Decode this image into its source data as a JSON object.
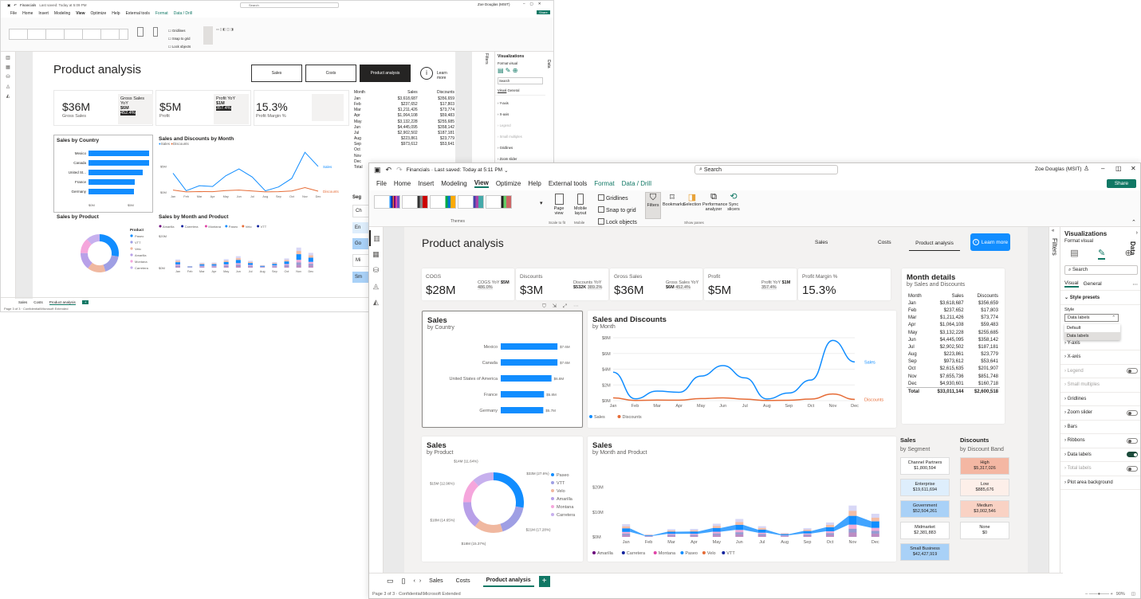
{
  "app": {
    "filename": "Financials",
    "saved": "Last saved: Today at 5:11 PM",
    "search_placeholder": "Search",
    "user": "Zoe Douglas (MSIT)",
    "share": "Share"
  },
  "back_app": {
    "saved": "Last saved: Today at 5:09 PM",
    "user": "Zoe Douglas (MSIT)"
  },
  "menu": [
    "File",
    "Home",
    "Insert",
    "Modeling",
    "View",
    "Optimize",
    "Help",
    "External tools",
    "Format",
    "Data / Drill"
  ],
  "ribbon": {
    "themes_label": "Themes",
    "page_view": "Page view",
    "mobile_layout": "Mobile layout",
    "scale_to_fit": "Scale to fit",
    "mobile": "Mobile",
    "gridlines": "Gridlines",
    "snap_to_grid": "Snap to grid",
    "lock_objects": "Lock objects",
    "filters": "Filters",
    "bookmarks": "Bookmarks",
    "selection": "Selection",
    "performance": "Performance analyzer",
    "sync": "Sync slicers",
    "show_panes": "Show panes"
  },
  "report": {
    "title": "Product analysis",
    "nav": [
      "Sales",
      "Costs",
      "Product analysis"
    ],
    "learn_more": "Learn more",
    "kpis": [
      {
        "label": "COGS",
        "value": "$28M",
        "sub_label": "COGS YoY",
        "sub_value": "$5M",
        "sub_pct": "486.0%"
      },
      {
        "label": "Discounts",
        "value": "$3M",
        "sub_label": "Discounts YoY",
        "sub_value": "$532K",
        "sub_pct": "389.2%"
      },
      {
        "label": "Gross Sales",
        "value": "$36M",
        "sub_label": "Gross Sales YoY",
        "sub_value": "$6M",
        "sub_pct": "452.4%"
      },
      {
        "label": "Profit",
        "value": "$5M",
        "sub_label": "Profit YoY",
        "sub_value": "$1M",
        "sub_pct": "357.4%"
      },
      {
        "label": "Profit Margin %",
        "value": "15.3%"
      }
    ],
    "month_details": {
      "title": "Month details",
      "subtitle": "by Sales and Discounts",
      "headers": [
        "Month",
        "Sales",
        "Discounts"
      ],
      "rows": [
        [
          "Jan",
          "$3,618,687",
          "$356,659"
        ],
        [
          "Feb",
          "$237,652",
          "$17,803"
        ],
        [
          "Mar",
          "$1,211,426",
          "$73,774"
        ],
        [
          "Apr",
          "$1,064,108",
          "$59,483"
        ],
        [
          "May",
          "$3,132,228",
          "$255,685"
        ],
        [
          "Jun",
          "$4,445,095",
          "$358,142"
        ],
        [
          "Jul",
          "$2,902,502",
          "$187,181"
        ],
        [
          "Aug",
          "$223,861",
          "$23,779"
        ],
        [
          "Sep",
          "$973,612",
          "$53,641"
        ],
        [
          "Oct",
          "$2,615,635",
          "$201,907"
        ],
        [
          "Nov",
          "$7,655,736",
          "$851,748"
        ],
        [
          "Dec",
          "$4,930,601",
          "$160,718"
        ]
      ],
      "total": [
        "Total",
        "$33,011,144",
        "$2,600,518"
      ]
    },
    "sales_country": {
      "title": "Sales",
      "subtitle": "by Country"
    },
    "sales_discounts": {
      "title": "Sales and Discounts",
      "subtitle": "by Month"
    },
    "sales_product": {
      "title": "Sales",
      "subtitle": "by Product"
    },
    "sales_month_product": {
      "title": "Sales",
      "subtitle": "by Month and Product"
    },
    "segment": {
      "title": "Sales",
      "subtitle": "by Segment",
      "items": [
        {
          "name": "Channel Partners",
          "value": "$1,800,594",
          "color": "#ffffff"
        },
        {
          "name": "Enterprise",
          "value": "$19,611,694",
          "color": "#deeefc"
        },
        {
          "name": "Government",
          "value": "$52,504,261",
          "color": "#a9d1f7"
        },
        {
          "name": "Midmarket",
          "value": "$2,381,883",
          "color": "#ffffff"
        },
        {
          "name": "Small Business",
          "value": "$42,427,919",
          "color": "#a9d1f7"
        }
      ]
    },
    "discount_band": {
      "title": "Discounts",
      "subtitle": "by Discount Band",
      "items": [
        {
          "name": "High",
          "value": "$5,317,026",
          "color": "#f4b7a3"
        },
        {
          "name": "Low",
          "value": "$885,676",
          "color": "#fdefe9"
        },
        {
          "name": "Medium",
          "value": "$3,002,546",
          "color": "#f9d2c4"
        },
        {
          "name": "None",
          "value": "$0",
          "color": "#ffffff"
        }
      ]
    }
  },
  "back_report": {
    "title": "Product analysis",
    "nav": [
      "Sales",
      "Costs",
      "Product analysis"
    ],
    "learn_more": "Learn more",
    "kpi1_value": "$36M",
    "kpi1_label": "Gross Sales",
    "kpi1_sub": "Gross Sales YoY",
    "kpi1_sub_val": "$6M",
    "kpi1_pct": "452.4%",
    "kpi2_value": "$5M",
    "kpi2_label": "Profit",
    "kpi2_sub": "Profit YoY",
    "kpi2_sub_val": "$1M",
    "kpi2_pct": "357.4%",
    "kpi3_value": "15.3%",
    "kpi3_label": "Profit Margin %",
    "country_title": "Sales by Country",
    "sd_title": "Sales and Discounts by Month",
    "legend_sales": "Sales",
    "legend_discounts": "Discounts",
    "product_title": "Sales by Product",
    "mp_title": "Sales by Month and Product",
    "product_label": "Product",
    "table_headers": [
      "Month",
      "Sales",
      "Discounts"
    ],
    "table_rows": [
      [
        "Jan",
        "$3,618,687",
        "$356,659"
      ],
      [
        "Feb",
        "$237,652",
        "$17,803"
      ],
      [
        "Mar",
        "$1,211,426",
        "$73,774"
      ],
      [
        "Apr",
        "$1,064,108",
        "$59,483"
      ],
      [
        "May",
        "$3,132,228",
        "$255,685"
      ],
      [
        "Jun",
        "$4,445,095",
        "$358,142"
      ],
      [
        "Jul",
        "$2,902,502",
        "$187,181"
      ],
      [
        "Aug",
        "$223,861",
        "$23,779"
      ],
      [
        "Sep",
        "$973,612",
        "$53,641"
      ],
      [
        "Oct",
        ""
      ],
      [
        "Nov",
        ""
      ],
      [
        "Dec",
        ""
      ],
      [
        "Total",
        ""
      ]
    ],
    "seg_partial": [
      "Seg",
      "Ch",
      "En",
      "Go",
      "Mi",
      "Sm"
    ],
    "tabs": [
      "Sales",
      "Costs",
      "Product analysis"
    ],
    "status": "Page 3 of 3  ·  Confidential\\Microsoft Extended"
  },
  "viz_pane": {
    "title": "Visualizations",
    "data_label": "Data",
    "filters_label": "Filters",
    "format_visual": "Format visual",
    "search": "Search",
    "tab_visual": "Visual",
    "tab_general": "General",
    "style_presets": "Style presets",
    "style_label": "Style",
    "style_value": "Data labels",
    "options": [
      "Default",
      "Data labels"
    ],
    "sections": [
      {
        "name": "Y-axis",
        "toggle": null
      },
      {
        "name": "X-axis",
        "toggle": null
      },
      {
        "name": "Legend",
        "toggle": "Off",
        "disabled": true
      },
      {
        "name": "Small multiples",
        "toggle": null,
        "disabled": true
      },
      {
        "name": "Gridlines",
        "toggle": null
      },
      {
        "name": "Zoom slider",
        "toggle": "Off"
      },
      {
        "name": "Bars",
        "toggle": null
      },
      {
        "name": "Ribbons",
        "toggle": "Off"
      },
      {
        "name": "Data labels",
        "toggle": "On"
      },
      {
        "name": "Total labels",
        "toggle": "Off",
        "disabled": true
      },
      {
        "name": "Plot area background",
        "toggle": null
      }
    ]
  },
  "back_viz": {
    "title": "Visualizations",
    "format_visual": "Format visual",
    "search": "Search",
    "tab_visual": "Visual",
    "tab_general": "General",
    "sections": [
      "Y-axis",
      "X-axis",
      "Legend",
      "Small multiples",
      "Gridlines",
      "Zoom slider"
    ]
  },
  "tabs": [
    "Sales",
    "Costs",
    "Product analysis"
  ],
  "status": "Page 3 of 3  ·  Confidential\\Microsoft Extended",
  "zoom": "90%",
  "chart_data": [
    {
      "type": "bar",
      "title": "Sales",
      "subtitle": "by Country",
      "categories": [
        "Mexico",
        "Canada",
        "United States of America",
        "France",
        "Germany"
      ],
      "values": [
        7.6,
        7.6,
        6.8,
        5.8,
        5.7
      ],
      "labels": [
        "$7.6M",
        "$7.6M",
        "$6.8M",
        "$5.8M",
        "$5.7M"
      ],
      "color": "#118dff"
    },
    {
      "type": "line",
      "title": "Sales and Discounts",
      "subtitle": "by Month",
      "categories": [
        "Jan",
        "Feb",
        "Mar",
        "Apr",
        "May",
        "Jun",
        "Jul",
        "Aug",
        "Sep",
        "Oct",
        "Nov",
        "Dec"
      ],
      "yticks": [
        "$0M",
        "$2M",
        "$4M",
        "$6M",
        "$8M"
      ],
      "ylim": [
        0,
        8
      ],
      "series": [
        {
          "name": "Sales",
          "color": "#118dff",
          "values": [
            3.62,
            0.24,
            1.21,
            1.06,
            3.13,
            4.45,
            2.9,
            0.22,
            0.97,
            2.62,
            7.66,
            4.93
          ]
        },
        {
          "name": "Discounts",
          "color": "#e66c37",
          "values": [
            0.36,
            0.02,
            0.07,
            0.06,
            0.26,
            0.36,
            0.19,
            0.02,
            0.05,
            0.2,
            0.85,
            0.16
          ]
        }
      ],
      "legend": "bottom-left"
    },
    {
      "type": "pie",
      "title": "Sales",
      "subtitle": "by Product",
      "categories": [
        "Paseo",
        "VTT",
        "Velo",
        "Amarilla",
        "Montana",
        "Carretera"
      ],
      "values": [
        27.6,
        17.28,
        15.37,
        14.65,
        12.96,
        11.64
      ],
      "labels": [
        "$33M (27.6%)",
        "$21M (17.28%)",
        "$18M (15.37%)",
        "$18M (14.65%)",
        "$15M (12.96%)",
        "$14M (11.64%)"
      ],
      "colors": [
        "#118dff",
        "#9f9fe4",
        "#f0b8a0",
        "#b8a0e8",
        "#f5a6dc",
        "#c7b0ee"
      ]
    },
    {
      "type": "bar",
      "title": "Sales",
      "subtitle": "by Month and Product",
      "categories": [
        "Jan",
        "Feb",
        "Mar",
        "Apr",
        "May",
        "Jun",
        "Jul",
        "Aug",
        "Sep",
        "Oct",
        "Nov",
        "Dec"
      ],
      "yticks": [
        "$0M",
        "$10M",
        "$20M"
      ],
      "ylim": [
        0,
        25
      ],
      "series": [
        {
          "name": "Amarilla",
          "color": "#6b007b"
        },
        {
          "name": "Carretera",
          "color": "#12239e"
        },
        {
          "name": "Montana",
          "color": "#e044a7"
        },
        {
          "name": "Paseo",
          "color": "#118dff"
        },
        {
          "name": "Velo",
          "color": "#e66c37"
        },
        {
          "name": "VTT",
          "color": "#12239e"
        }
      ],
      "totals": [
        5.1,
        1.0,
        3.1,
        3.2,
        5.3,
        7.2,
        4.3,
        1.6,
        3.5,
        5.8,
        12.6,
        9.3
      ],
      "legend": "bottom-left"
    }
  ]
}
